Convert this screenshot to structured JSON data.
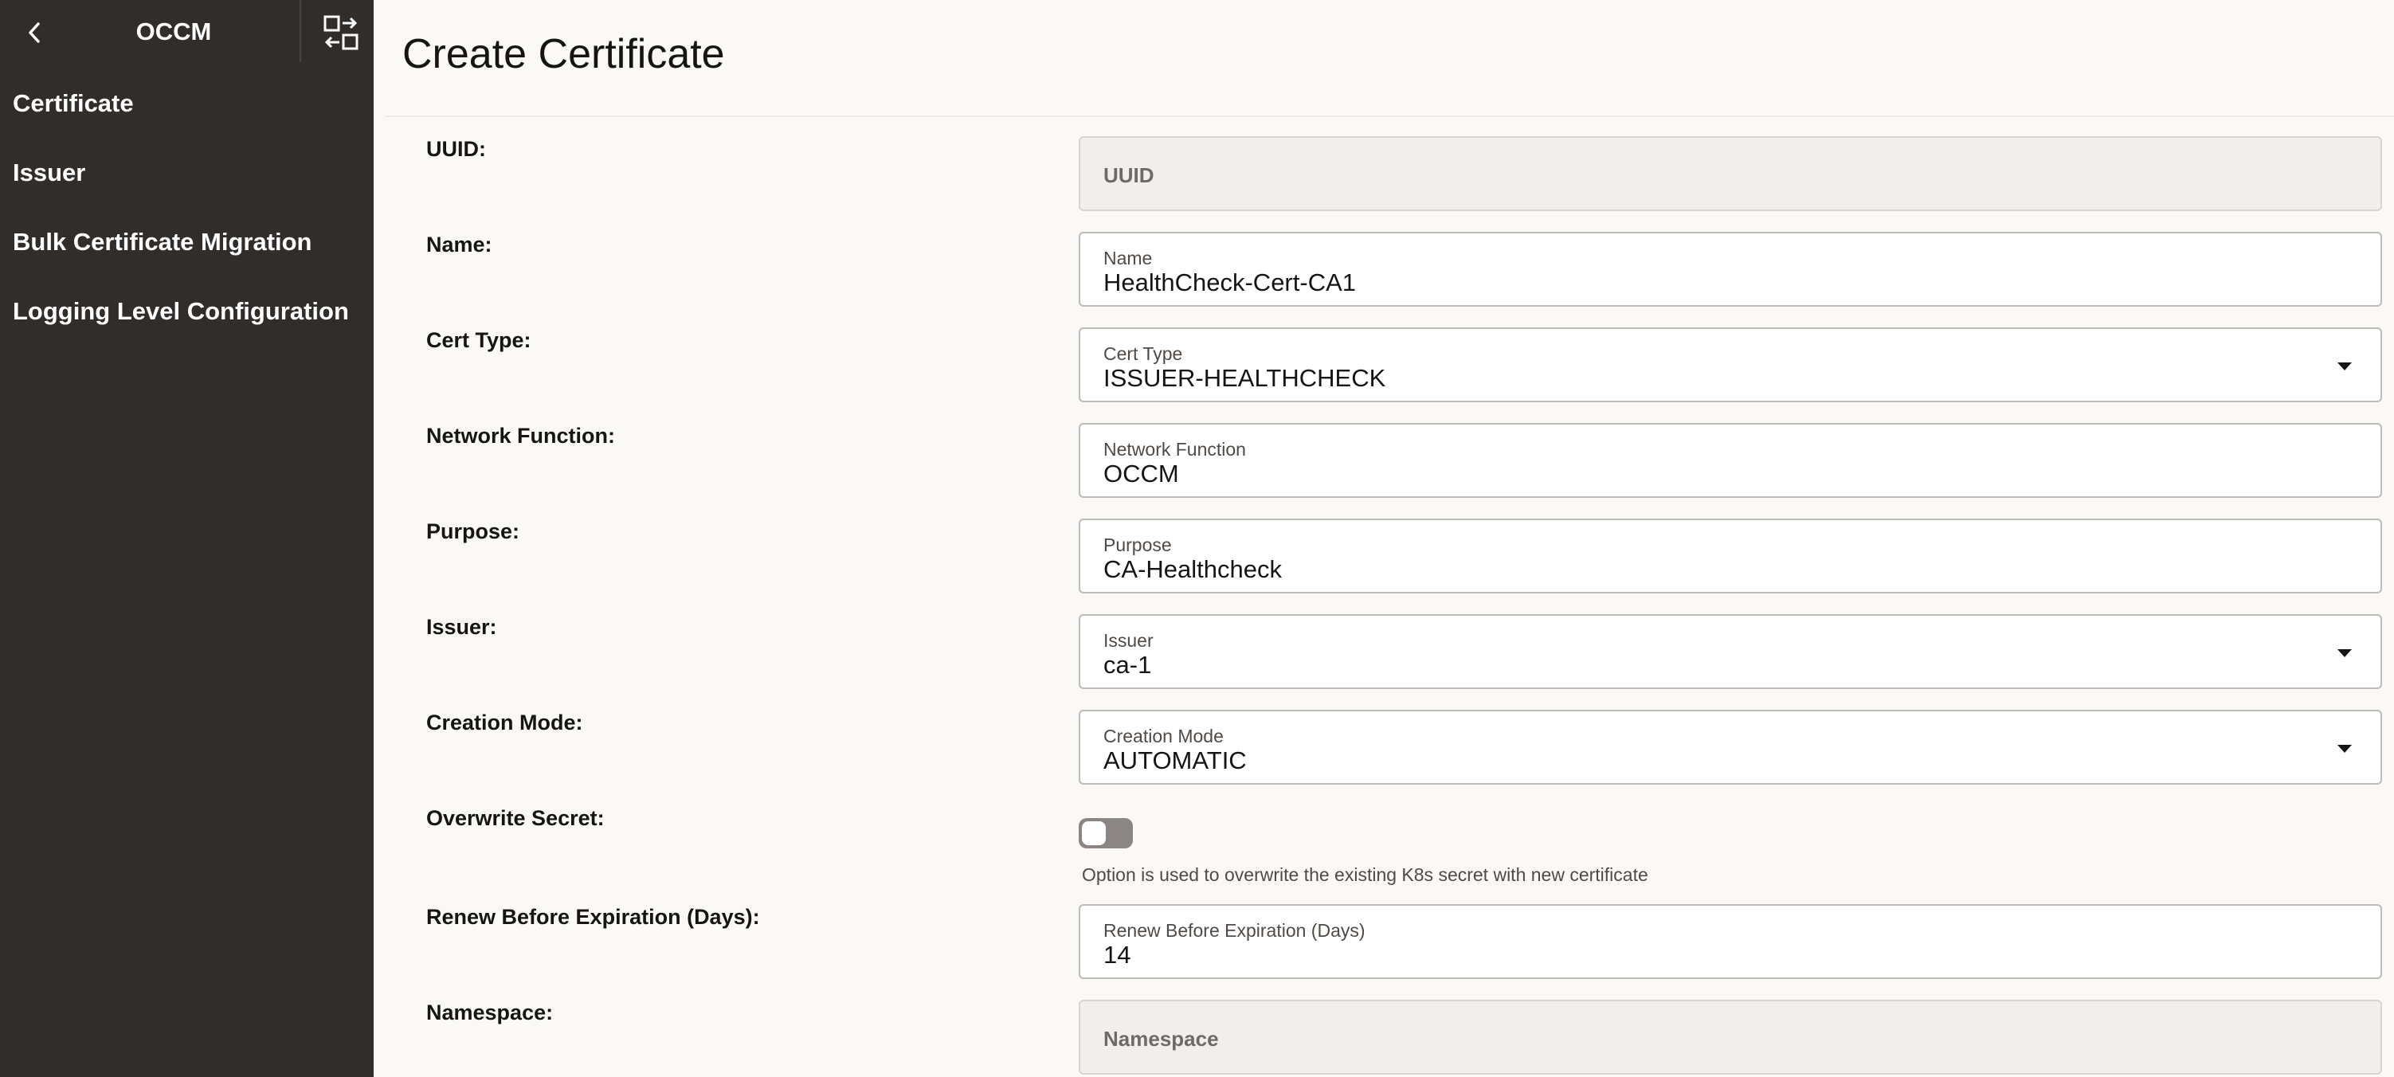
{
  "sidebar": {
    "title": "OCCM",
    "items": [
      {
        "label": "Certificate"
      },
      {
        "label": "Issuer"
      },
      {
        "label": "Bulk Certificate Migration"
      },
      {
        "label": "Logging Level Configuration"
      }
    ]
  },
  "page": {
    "title": "Create Certificate"
  },
  "form": {
    "uuid": {
      "row_label": "UUID:",
      "placeholder": "UUID"
    },
    "name": {
      "row_label": "Name:",
      "field_label": "Name",
      "value": "HealthCheck-Cert-CA1"
    },
    "cert_type": {
      "row_label": "Cert Type:",
      "field_label": "Cert Type",
      "value": "ISSUER-HEALTHCHECK"
    },
    "network_function": {
      "row_label": "Network Function:",
      "field_label": "Network Function",
      "value": "OCCM"
    },
    "purpose": {
      "row_label": "Purpose:",
      "field_label": "Purpose",
      "value": "CA-Healthcheck"
    },
    "issuer": {
      "row_label": "Issuer:",
      "field_label": "Issuer",
      "value": "ca-1"
    },
    "creation_mode": {
      "row_label": "Creation Mode:",
      "field_label": "Creation Mode",
      "value": "AUTOMATIC"
    },
    "overwrite_secret": {
      "row_label": "Overwrite Secret:",
      "help": "Option is used to overwrite the existing K8s secret with new certificate",
      "enabled": false
    },
    "renew_before": {
      "row_label": "Renew Before Expiration (Days):",
      "field_label": "Renew Before Expiration (Days)",
      "value": "14"
    },
    "namespace": {
      "row_label": "Namespace:",
      "placeholder": "Namespace"
    }
  },
  "icons": {
    "back": "chevron-left-icon",
    "collapse": "collapse-panel-icon",
    "dropdown": "caret-down-icon"
  }
}
